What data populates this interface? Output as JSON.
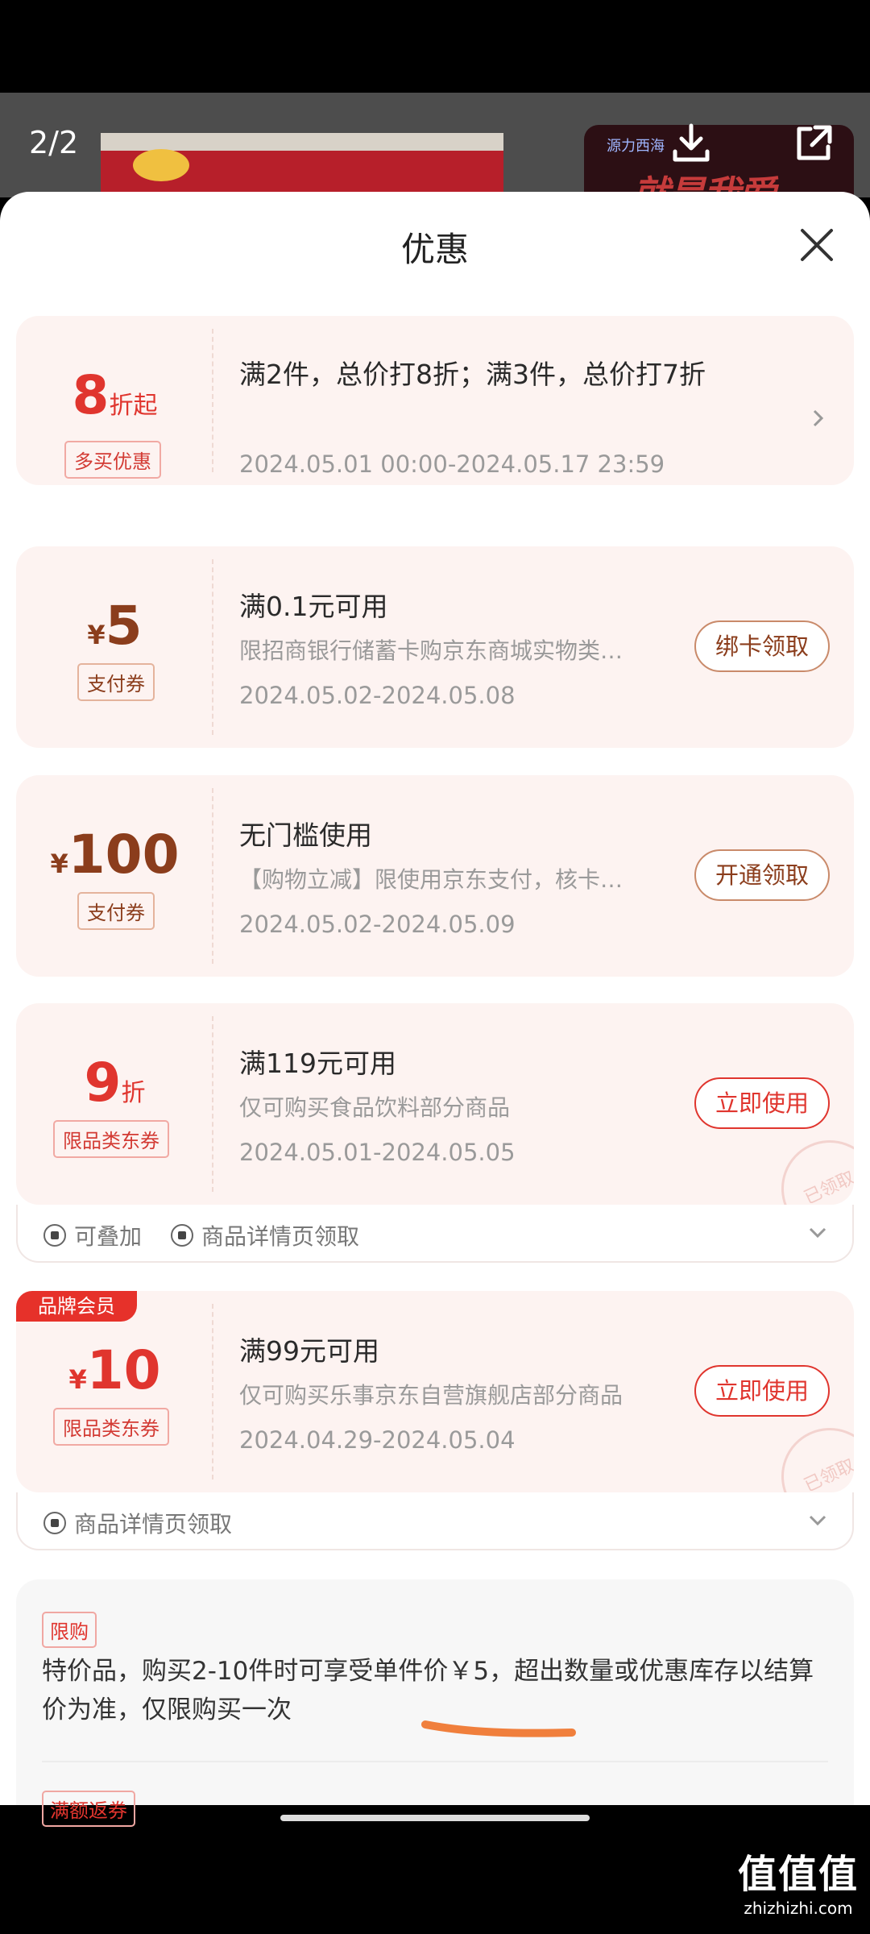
{
  "viewer": {
    "page_indicator": "2/2",
    "thumb_small_text": "源力西海",
    "thumb_text": "就是我爱"
  },
  "sheet": {
    "title": "优惠"
  },
  "cards": [
    {
      "amount_main": "8",
      "amount_suffix": "折起",
      "tag": "多买优惠",
      "title": "满2件，总价打8折；满3件，总价打7折",
      "dates": "2024.05.01 00:00-2024.05.17 23:59"
    },
    {
      "currency": "¥",
      "amount_main": "5",
      "tag": "支付券",
      "title": "满0.1元可用",
      "desc": "限招商银行储蓄卡购京东商城实物类…",
      "dates": "2024.05.02-2024.05.08",
      "button": "绑卡领取"
    },
    {
      "currency": "¥",
      "amount_main": "100",
      "tag": "支付券",
      "title": "无门槛使用",
      "desc": "【购物立减】限使用京东支付，核卡…",
      "dates": "2024.05.02-2024.05.09",
      "button": "开通领取"
    },
    {
      "amount_main": "9",
      "amount_suffix": "折",
      "tag": "限品类东券",
      "title": "满119元可用",
      "desc": "仅可购买食品饮料部分商品",
      "dates": "2024.05.01-2024.05.05",
      "button": "立即使用",
      "stamp": "已领取",
      "sub_items": [
        "可叠加",
        "商品详情页领取"
      ]
    },
    {
      "badge": "品牌会员",
      "currency": "¥",
      "amount_main": "10",
      "tag": "限品类东券",
      "title": "满99元可用",
      "desc": "仅可购买乐事京东自营旗舰店部分商品",
      "dates": "2024.04.29-2024.05.04",
      "button": "立即使用",
      "stamp": "已领取",
      "sub_items": [
        "商品详情页领取"
      ]
    }
  ],
  "limit": {
    "tag": "限购",
    "text": "特价品，购买2-10件时可享受单件价￥5，超出数量或优惠库存以结算价为准，仅限购买一次",
    "next_tag": "满额返券"
  },
  "watermark": {
    "big": "值值值",
    "small": "zhizhizhi.com"
  },
  "colors": {
    "accent_red": "#e0352e",
    "accent_brown": "#8b3d1c",
    "card_bg": "#fdf3f1"
  }
}
